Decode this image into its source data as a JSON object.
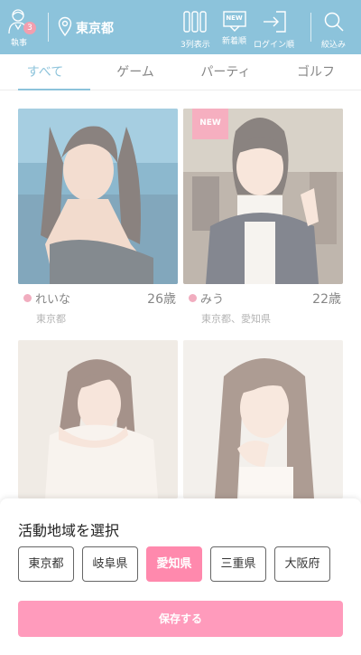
{
  "header": {
    "butler_label": "執事",
    "butler_badge": "3",
    "location": "東京都",
    "view_3col_label": "3列表示",
    "newest_label": "新着順",
    "newest_icon_text": "NEW",
    "login_label": "ログイン順",
    "narrow_label": "絞込み"
  },
  "tabs": [
    {
      "label": "すべて",
      "active": true
    },
    {
      "label": "ゲーム",
      "active": false
    },
    {
      "label": "パーティ",
      "active": false
    },
    {
      "label": "ゴルフ",
      "active": false
    }
  ],
  "cards": [
    {
      "name": "れいな",
      "age": "26歳",
      "area": "東京都",
      "is_new": false
    },
    {
      "name": "みう",
      "age": "22歳",
      "area": "東京都、愛知県",
      "is_new": true,
      "new_label": "NEW"
    },
    {
      "name": "",
      "age": "",
      "area": "",
      "is_new": false
    },
    {
      "name": "",
      "age": "",
      "area": "",
      "is_new": false
    }
  ],
  "sheet": {
    "title": "活動地域を選択",
    "prefectures": [
      {
        "label": "東京都",
        "selected": false
      },
      {
        "label": "岐阜県",
        "selected": false
      },
      {
        "label": "愛知県",
        "selected": true
      },
      {
        "label": "三重県",
        "selected": false
      },
      {
        "label": "大阪府",
        "selected": false
      }
    ],
    "save_label": "保存する"
  },
  "colors": {
    "header_bg": "#2f93bd",
    "accent_pink": "#ff89ad",
    "save_pink": "#ff9bbc",
    "badge_red": "#e8506d"
  }
}
